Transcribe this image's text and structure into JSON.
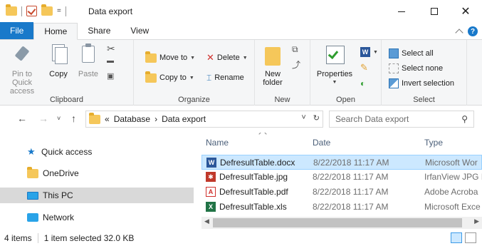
{
  "window": {
    "title": "Data export",
    "qat_dropdown": "="
  },
  "tabs": [
    "File",
    "Home",
    "Share",
    "View"
  ],
  "ribbon": {
    "clipboard": {
      "label": "Clipboard",
      "pin_label": "Pin to Quick access",
      "copy_label": "Copy",
      "paste_label": "Paste"
    },
    "organize": {
      "label": "Organize",
      "move_to": "Move to",
      "copy_to": "Copy to",
      "delete": "Delete",
      "rename": "Rename"
    },
    "new": {
      "label": "New",
      "new_folder": "New folder"
    },
    "open": {
      "label": "Open",
      "properties": "Properties"
    },
    "select": {
      "label": "Select",
      "select_all": "Select all",
      "select_none": "Select none",
      "invert_selection": "Invert selection"
    }
  },
  "address": {
    "prefix": "«",
    "crumb1": "Database",
    "separator": "›",
    "crumb2": "Data export",
    "search_placeholder": "Search Data export"
  },
  "nav": {
    "quick_access": "Quick access",
    "onedrive": "OneDrive",
    "this_pc": "This PC",
    "network": "Network"
  },
  "columns": {
    "name": "Name",
    "date": "Date",
    "type": "Type"
  },
  "files": [
    {
      "name": "DefresultTable.docx",
      "date": "8/22/2018 11:17 AM",
      "type": "Microsoft Wor",
      "icon": "word-icon",
      "selected": true
    },
    {
      "name": "DefresultTable.jpg",
      "date": "8/22/2018 11:17 AM",
      "type": "IrfanView JPG I",
      "icon": "irfanview-icon",
      "selected": false
    },
    {
      "name": "DefresultTable.pdf",
      "date": "8/22/2018 11:17 AM",
      "type": "Adobe Acroba",
      "icon": "pdf-icon",
      "selected": false
    },
    {
      "name": "DefresultTable.xls",
      "date": "8/22/2018 11:17 AM",
      "type": "Microsoft Exce",
      "icon": "excel-icon",
      "selected": false
    }
  ],
  "status": {
    "items": "4 items",
    "selection": "1 item selected  32.0 KB"
  },
  "colors": {
    "accent": "#1979ca",
    "selected_row": "#cce8ff",
    "nav_selected": "#d9d9d9"
  }
}
